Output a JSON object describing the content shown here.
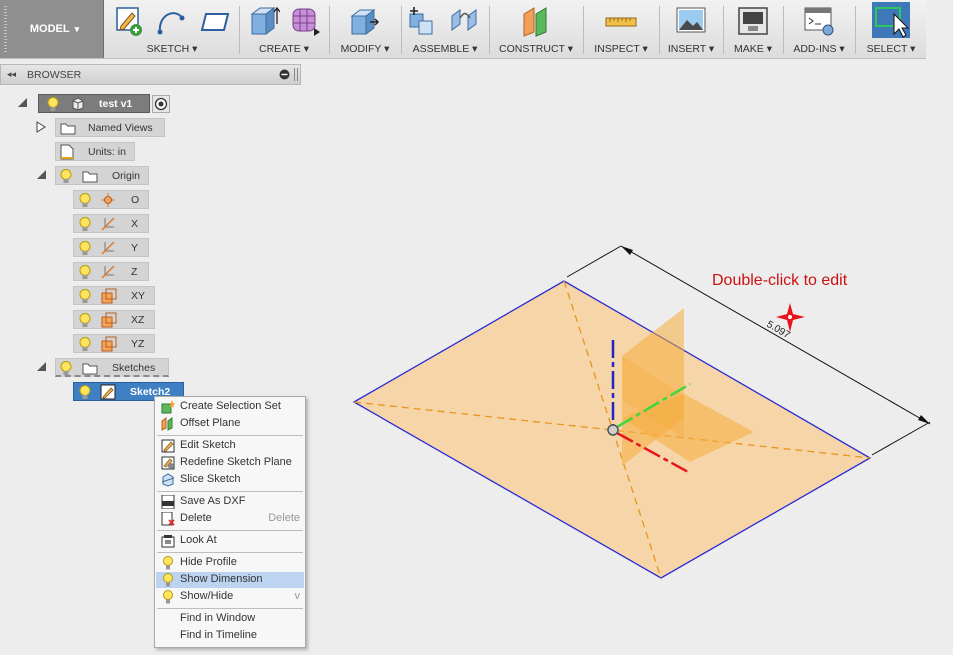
{
  "toolbar": {
    "workspace": "MODEL",
    "groups": [
      {
        "label": "SKETCH"
      },
      {
        "label": "CREATE"
      },
      {
        "label": "MODIFY"
      },
      {
        "label": "ASSEMBLE"
      },
      {
        "label": "CONSTRUCT"
      },
      {
        "label": "INSPECT"
      },
      {
        "label": "INSERT"
      },
      {
        "label": "MAKE"
      },
      {
        "label": "ADD-INS"
      },
      {
        "label": "SELECT"
      }
    ],
    "dropdown_glyph": "▾"
  },
  "browser": {
    "title": "BROWSER",
    "collapse_glyph": "◂◂",
    "root": {
      "label": "test v1"
    },
    "named_views": {
      "label": "Named Views"
    },
    "units": {
      "label": "Units: in"
    },
    "origin": {
      "label": "Origin",
      "items": [
        {
          "label": "O"
        },
        {
          "label": "X"
        },
        {
          "label": "Y"
        },
        {
          "label": "Z"
        },
        {
          "label": "XY"
        },
        {
          "label": "XZ"
        },
        {
          "label": "YZ"
        }
      ]
    },
    "sketches": {
      "label": "Sketches",
      "items": [
        {
          "label": "Sketch2"
        }
      ]
    }
  },
  "context_menu": {
    "items": [
      {
        "label": "Create Selection Set",
        "shortcut": ""
      },
      {
        "label": "Offset Plane",
        "shortcut": ""
      },
      {
        "label": "Edit Sketch",
        "shortcut": ""
      },
      {
        "label": "Redefine Sketch Plane",
        "shortcut": ""
      },
      {
        "label": "Slice Sketch",
        "shortcut": ""
      },
      {
        "label": "Save As DXF",
        "shortcut": ""
      },
      {
        "label": "Delete",
        "shortcut": "Delete"
      },
      {
        "label": "Look At",
        "shortcut": ""
      },
      {
        "label": "Hide Profile",
        "shortcut": ""
      },
      {
        "label": "Show Dimension",
        "shortcut": ""
      },
      {
        "label": "Show/Hide",
        "shortcut": "v"
      },
      {
        "label": "Find in Window",
        "shortcut": ""
      },
      {
        "label": "Find in Timeline",
        "shortcut": ""
      }
    ]
  },
  "viewport": {
    "hint": "Double-click to edit",
    "dimension_value": "5.097",
    "colors": {
      "plane_fill": "#f7cf96",
      "plane_edge": "#2b2bd6",
      "axis_red": "#e8141c",
      "axis_green": "#3fd63f",
      "axis_blue": "#2323c8",
      "hint": "#cc1111"
    }
  }
}
